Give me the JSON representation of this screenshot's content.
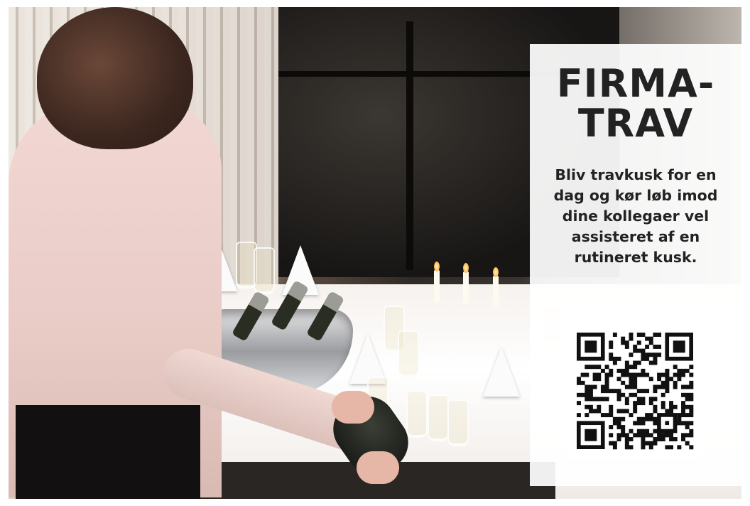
{
  "promo": {
    "title_line1": "FIRMA-",
    "title_line2": "TRAV",
    "description": "Bliv travkusk for en dag og kør løb imod dine kollegaer vel assisteret af en rutineret kusk."
  },
  "colors": {
    "panel_background": "#ffffff",
    "text": "#222222"
  },
  "icons": {
    "qr": "qr-code-icon"
  }
}
